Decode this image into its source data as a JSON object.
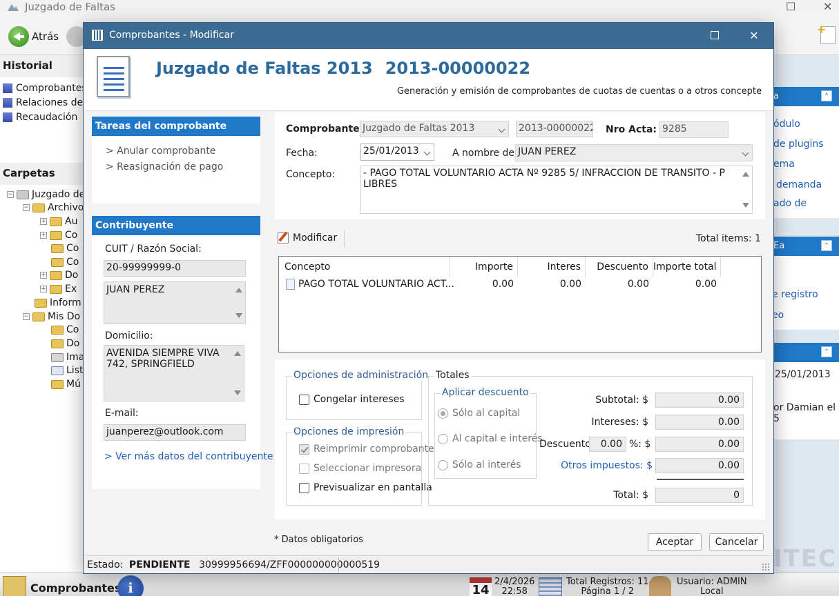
{
  "background_app": {
    "title": "Juzgado de Faltas",
    "toolbar": {
      "back_label": "Atrás"
    },
    "historial": {
      "heading": "Historial",
      "items": [
        "Comprobantes",
        "Relaciones de P",
        "Recaudación"
      ]
    },
    "carpetas": {
      "heading": "Carpetas",
      "tree": [
        "Juzgado de",
        "Archivo",
        "Au",
        "Co",
        "Co",
        "Co",
        "Do",
        "Ex",
        "Inform",
        "Mis Do",
        "Co",
        "Do",
        "Ima",
        "List",
        "Mú"
      ]
    },
    "right_panel": {
      "sections": [
        {
          "head": "a",
          "links": [
            "ódulo",
            "de plugins",
            "ema",
            "demanda",
            "ado de"
          ]
        },
        {
          "head": "Ea",
          "links": [
            "e registro",
            "eo"
          ]
        },
        {
          "head": "",
          "lines": [
            ") 25/01/2013",
            "or Damian el",
            "5"
          ]
        }
      ]
    },
    "bottom": {
      "title": "Comprobantes",
      "cal_day": "14",
      "date": "2/4/2026",
      "time": "22:58",
      "total_registros": "Total Registros: 11",
      "pagina": "Página 1 / 2",
      "usuario": "Usuario: ADMIN",
      "local": "Local",
      "watermark": "ITEC"
    }
  },
  "dialog": {
    "title": "Comprobantes - Modificar",
    "header": {
      "title": "Juzgado de Faltas 2013",
      "number": "2013-00000022",
      "subtitle": "Generación y emisión de comprobantes de cuotas de cuentas o a otros concepte"
    },
    "tasks": {
      "heading": "Tareas del comprobante",
      "items": [
        "> Anular comprobante",
        "> Reasignación de pago"
      ]
    },
    "contribuyente": {
      "heading": "Contribuyente",
      "cuit_label": "CUIT / Razón Social:",
      "cuit": "20-99999999-0",
      "razon_social": "JUAN PEREZ",
      "domicilio_label": "Domicilio:",
      "domicilio": "AVENIDA SIEMPRE VIVA 742, SPRINGFIELD",
      "email_label": "E-mail:",
      "email": "juanperez@outlook.com",
      "more_link": "> Ver más datos del contribuyente"
    },
    "form": {
      "comprobante_label": "Comprobante:",
      "comprobante_value": "Juzgado de Faltas 2013",
      "comprobante_number": "2013-00000022",
      "nro_acta_label": "Nro Acta:",
      "nro_acta": "9285",
      "fecha_label": "Fecha:",
      "fecha": "25/01/2013",
      "a_nombre_label": "A nombre de:",
      "a_nombre": "JUAN PEREZ",
      "concepto_label": "Concepto:",
      "concepto": "- PAGO TOTAL VOLUNTARIO ACTA Nº 9285 5/ INFRACCION DE TRANSITO - P LIBRES"
    },
    "items_toolbar": {
      "modify_label": "Modificar",
      "total_items": "Total items: 1"
    },
    "items_table": {
      "columns": [
        "Concepto",
        "Importe",
        "Interes",
        "Descuento",
        "Importe total"
      ],
      "rows": [
        {
          "concepto": "PAGO TOTAL VOLUNTARIO ACT...",
          "importe": "0.00",
          "interes": "0.00",
          "descuento": "0.00",
          "importe_total": "0.00"
        }
      ]
    },
    "admin_options": {
      "title": "Opciones de administración",
      "congelar": "Congelar intereses"
    },
    "print_options": {
      "title": "Opciones de impresión",
      "reimprimir": "Reimprimir comprobante",
      "seleccionar": "Seleccionar impresora",
      "previsualizar": "Previsualizar en pantalla"
    },
    "totales": {
      "title": "Totales",
      "descuento_group": "Aplicar descuento",
      "radio_capital": "Sólo al capital",
      "radio_capital_interes": "Al capital e interés",
      "radio_interes": "Sólo al interés",
      "subtotal_label": "Subtotal: $",
      "subtotal": "0.00",
      "intereses_label": "Intereses: $",
      "intereses": "0.00",
      "descuento_label": "Descuento",
      "descuento_pct": "0.00",
      "pct_label": "%: $",
      "descuento": "0.00",
      "otros_label": "Otros impuestos: $",
      "otros": "0.00",
      "total_label": "Total: $",
      "total": "0"
    },
    "footer": {
      "required_note": "* Datos obligatorios",
      "accept": "Aceptar",
      "cancel": "Cancelar"
    },
    "status": {
      "estado_label": "Estado:",
      "estado": "PENDIENTE",
      "code": "30999956694/ZFF000000000000519"
    }
  }
}
